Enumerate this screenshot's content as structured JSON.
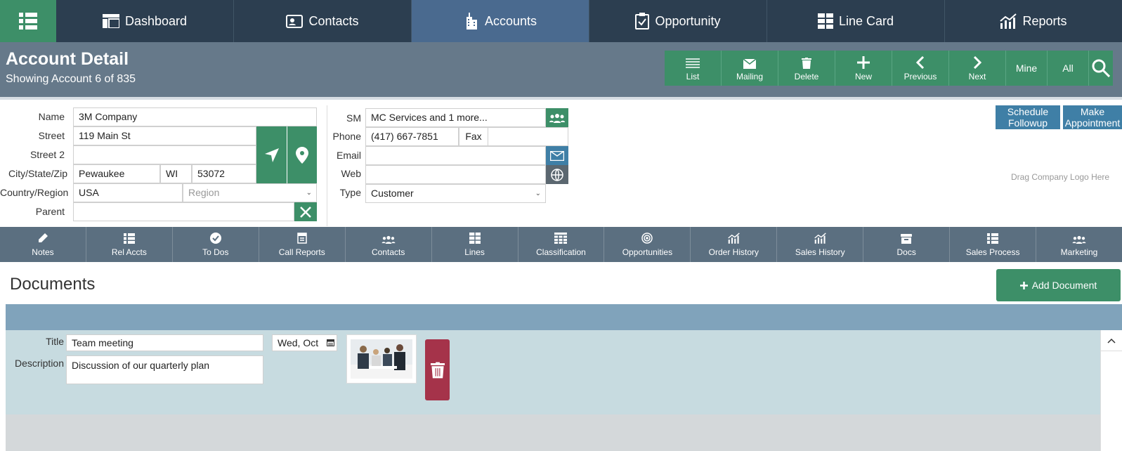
{
  "nav": {
    "items": [
      {
        "label": "Dashboard",
        "icon": "dashboard-icon"
      },
      {
        "label": "Contacts",
        "icon": "contact-card-icon"
      },
      {
        "label": "Accounts",
        "icon": "building-icon"
      },
      {
        "label": "Opportunity",
        "icon": "clipboard-icon"
      },
      {
        "label": "Line Card",
        "icon": "grid-icon"
      },
      {
        "label": "Reports",
        "icon": "chart-icon"
      }
    ],
    "active": "Accounts"
  },
  "header": {
    "title": "Account Detail",
    "subtitle": "Showing Account 6 of 835",
    "buttons": {
      "list": "List",
      "mailing": "Mailing",
      "delete": "Delete",
      "new": "New",
      "previous": "Previous",
      "next": "Next",
      "mine": "Mine",
      "all": "All"
    }
  },
  "form": {
    "labels": {
      "name": "Name",
      "street": "Street",
      "street2": "Street 2",
      "city_state_zip": "City/State/Zip",
      "country_region": "Country/Region",
      "parent": "Parent",
      "sm": "SM",
      "phone": "Phone",
      "fax": "Fax",
      "email": "Email",
      "web": "Web",
      "type": "Type"
    },
    "values": {
      "name": "3M Company",
      "street": "119 Main St",
      "street2": "",
      "city": "Pewaukee",
      "state": "WI",
      "zip": "53072",
      "country": "USA",
      "region_placeholder": "Region",
      "parent": "",
      "sm": "MC Services and 1 more...",
      "phone": "(417) 667-7851",
      "fax": "",
      "email": "",
      "web": "",
      "type": "Customer"
    }
  },
  "side_actions": {
    "schedule_followup": "Schedule Followup",
    "make_appointment": "Make Appointment",
    "logo_hint": "Drag Company Logo Here"
  },
  "tabs": [
    {
      "label": "Notes",
      "icon": "pencil-icon"
    },
    {
      "label": "Rel Accts",
      "icon": "list-icon"
    },
    {
      "label": "To Dos",
      "icon": "check-circle-icon"
    },
    {
      "label": "Call Reports",
      "icon": "report-icon"
    },
    {
      "label": "Contacts",
      "icon": "people-icon"
    },
    {
      "label": "Lines",
      "icon": "grid-icon"
    },
    {
      "label": "Classification",
      "icon": "table-icon"
    },
    {
      "label": "Opportunities",
      "icon": "target-icon"
    },
    {
      "label": "Order History",
      "icon": "chart-icon"
    },
    {
      "label": "Sales History",
      "icon": "chart-icon"
    },
    {
      "label": "Docs",
      "icon": "archive-icon"
    },
    {
      "label": "Sales Process",
      "icon": "list-icon"
    },
    {
      "label": "Marketing",
      "icon": "people-icon"
    }
  ],
  "documents": {
    "title": "Documents",
    "add_label": "Add Document",
    "row": {
      "title_label": "Title",
      "title_value": "Team meeting",
      "date_value": "Wed, Oct",
      "description_label": "Description",
      "description_value": "Discussion of our quarterly plan"
    }
  },
  "colors": {
    "nav_bg": "#2c3e50",
    "accent_green": "#3d8f68",
    "header_bg": "#66798a",
    "tab_bg": "#5b6f80",
    "action_blue": "#3f7fa6",
    "delete_red": "#a5334a"
  }
}
